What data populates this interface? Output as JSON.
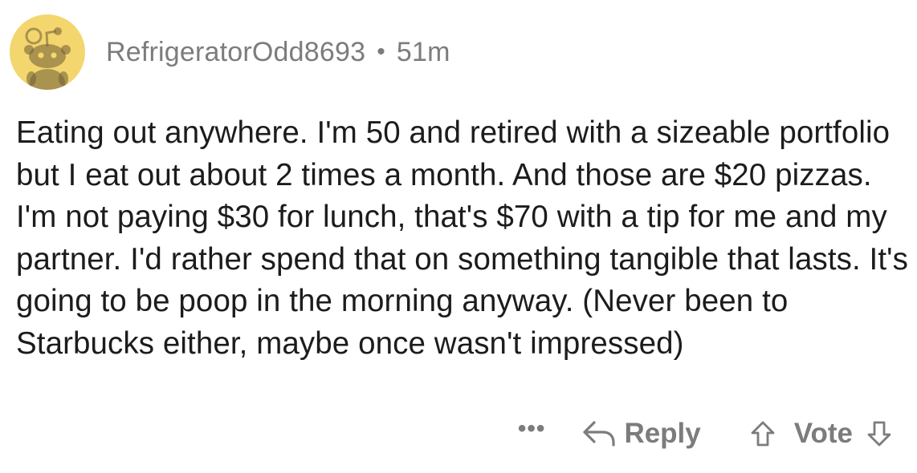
{
  "comment": {
    "username": "RefrigeratorOdd8693",
    "separator": "•",
    "time": "51m",
    "body": "Eating out anywhere. I'm 50 and retired with a sizeable portfolio but I eat out about 2 times a month. And those are $20 pizzas. I'm not paying $30 for lunch, that's $70 with a tip for me and my partner. I'd rather spend that on something tangible that lasts. It's going to be poop in the morning anyway. (Never been to Starbucks either, maybe once wasn't impressed)"
  },
  "actions": {
    "more_label": "•••",
    "reply_label": "Reply",
    "vote_label": "Vote"
  },
  "icons": {
    "avatar": "snoo-avatar-icon",
    "reply": "reply-arrow-icon",
    "upvote": "upvote-arrow-icon",
    "downvote": "downvote-arrow-icon"
  },
  "colors": {
    "avatar_bg": "#f4d66e",
    "meta_text": "#7c7c7c",
    "body_text": "#1c1c1c"
  }
}
